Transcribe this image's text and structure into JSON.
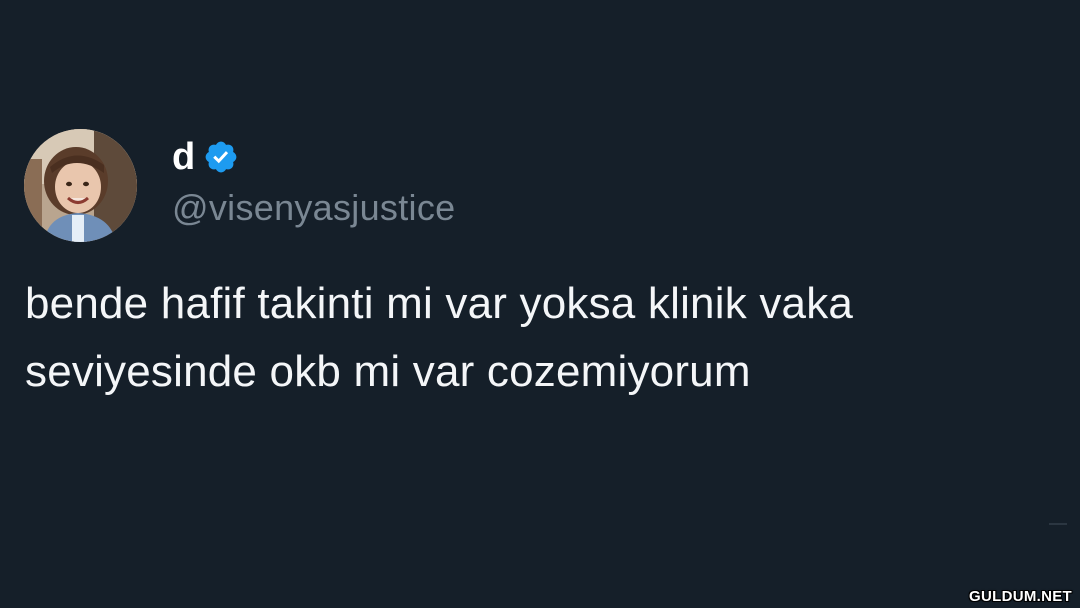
{
  "tweet": {
    "author": {
      "display_name": "d",
      "handle": "@visenyasjustice",
      "verified_icon": "verified-badge-icon",
      "avatar_icon": "profile-photo-child"
    },
    "text_lines": [
      "bende hafif takinti mi var yoksa klinik vaka",
      "seviyesinde okb mi var cozemiyorum"
    ]
  },
  "watermark": "GULDUM.NET",
  "colors": {
    "background": "#151f29",
    "text": "#f4f6f8",
    "handle": "#7a8793",
    "verified": "#1d9bf0"
  }
}
